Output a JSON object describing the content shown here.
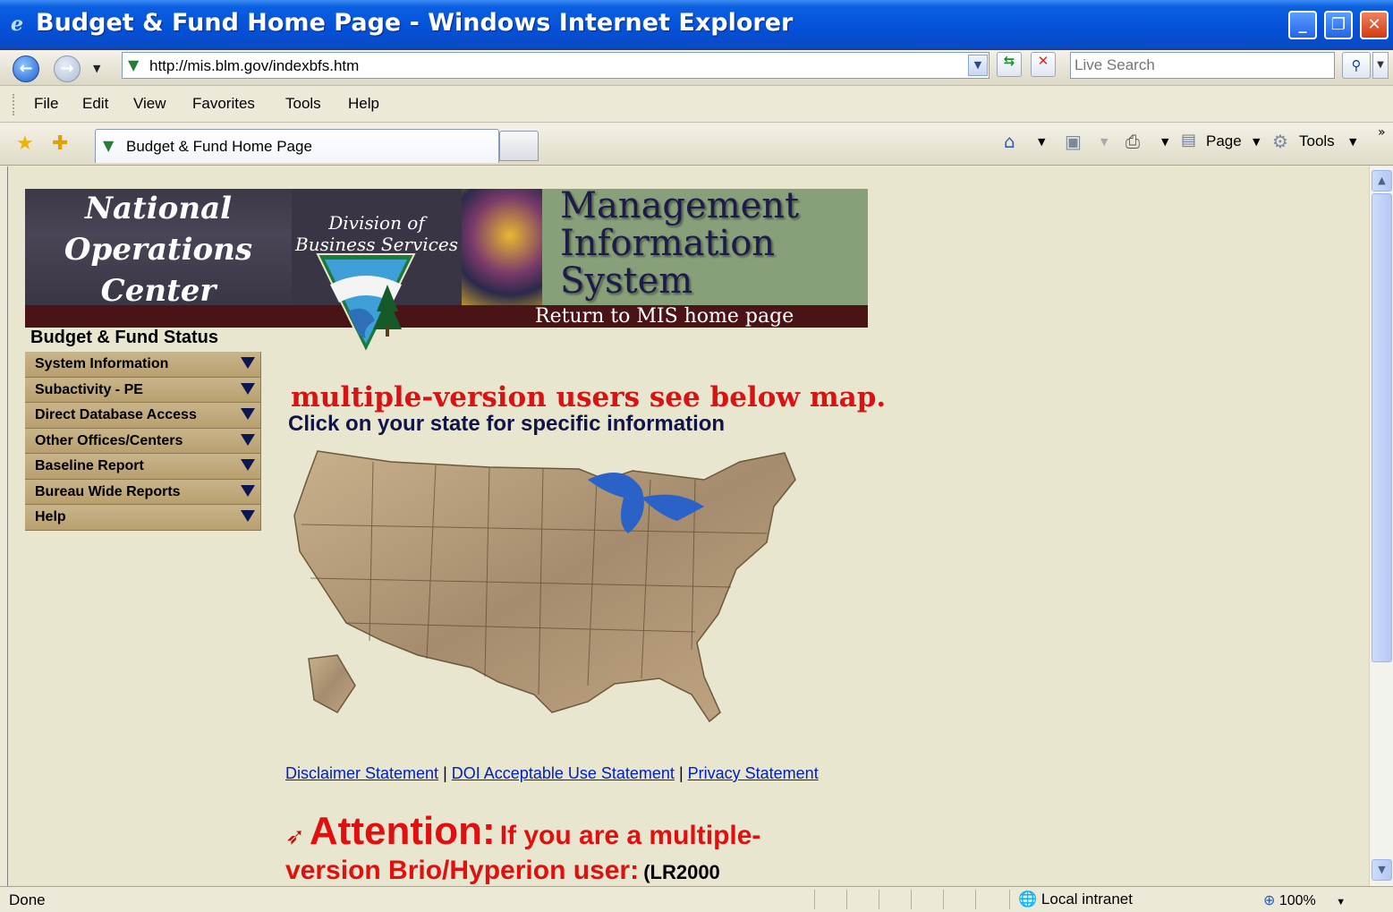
{
  "window": {
    "title": "Budget & Fund Home Page - Windows Internet Explorer",
    "minimize": "_",
    "maximize": "❐",
    "close": "✕"
  },
  "address": {
    "url": "http://mis.blm.gov/indexbfs.htm",
    "search_placeholder": "Live Search"
  },
  "menu": {
    "items": [
      "File",
      "Edit",
      "View",
      "Favorites",
      "Tools",
      "Help"
    ]
  },
  "tabs": {
    "active_title": "Budget & Fund Home Page"
  },
  "commands": {
    "page": "Page",
    "tools": "Tools"
  },
  "banner": {
    "noc_line1": "National",
    "noc_line2": "Operations",
    "noc_line3": "Center",
    "dbs_line1": "Division of",
    "dbs_line2": "Business Services",
    "mis_line1": "Management",
    "mis_line2": "Information",
    "mis_line3": "System",
    "return_link": "Return to MIS home page"
  },
  "sidebar": {
    "title": "Budget & Fund Status",
    "items": [
      {
        "label": "System Information"
      },
      {
        "label": "Subactivity - PE"
      },
      {
        "label": "Direct Database Access"
      },
      {
        "label": "Other Offices/Centers"
      },
      {
        "label": "Baseline Report"
      },
      {
        "label": "Bureau Wide Reports"
      },
      {
        "label": "Help"
      }
    ]
  },
  "main": {
    "headline1": "multiple-version users see below map.",
    "headline2": "Click on your state for specific information",
    "links": {
      "disclaimer": "Disclaimer Statement",
      "doi": "DOI Acceptable Use Statement",
      "privacy": "Privacy Statement",
      "separator": "|"
    },
    "attention_label": "Attention:",
    "attention_text1": "If you are a multiple-",
    "attention_text2": "version Brio/Hyperion user:",
    "attention_small": "(LR2000"
  },
  "status": {
    "text": "Done",
    "zone": "Local intranet",
    "zoom": "100%"
  }
}
